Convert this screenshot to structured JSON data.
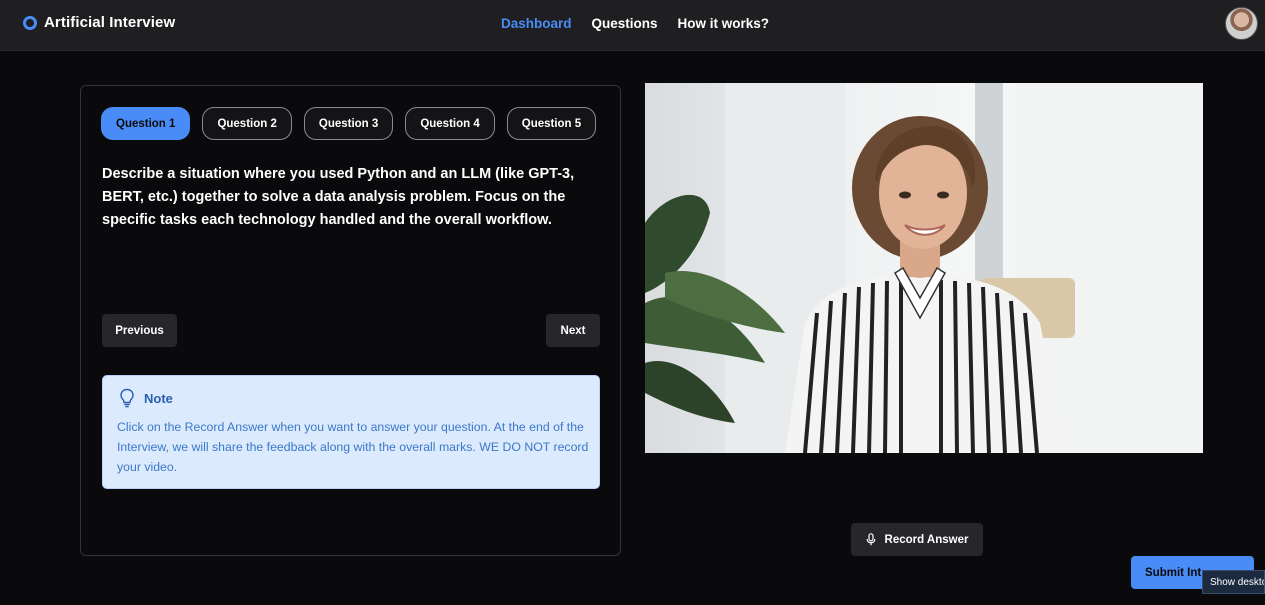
{
  "app": {
    "title": "Artificial Interview"
  },
  "nav": {
    "items": [
      {
        "label": "Dashboard",
        "active": true
      },
      {
        "label": "Questions",
        "active": false
      },
      {
        "label": "How it works?",
        "active": false
      }
    ]
  },
  "questions": {
    "tabs": [
      "Question 1",
      "Question 2",
      "Question 3",
      "Question 4",
      "Question 5"
    ],
    "active_index": 0,
    "current_text": "Describe a situation where you used Python and an LLM (like GPT-3, BERT, etc.) together to solve a data analysis problem. Focus on the specific tasks each technology handled and the overall workflow.",
    "previous_label": "Previous",
    "next_label": "Next"
  },
  "note": {
    "title": "Note",
    "body": "Click on the Record Answer when you want to answer your question. At the end of the Interview, we will share the feedback along with the overall marks. WE DO NOT record your video."
  },
  "video": {
    "icon": "video-feed"
  },
  "actions": {
    "record_label": "Record Answer",
    "submit_label": "Submit Int",
    "tooltip_text": "Show deskto"
  },
  "colors": {
    "accent": "#4a8cf7",
    "header_bg": "#1f1f22",
    "page_bg": "#0a0a0c",
    "note_bg": "#dceafd"
  }
}
